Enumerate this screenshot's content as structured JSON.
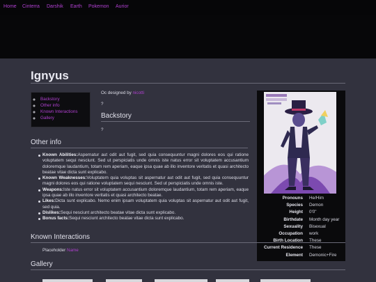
{
  "nav": [
    "Home",
    "Cinterra",
    "Darshik",
    "Earth",
    "Pokemon",
    "Aurior"
  ],
  "page_title": "Ignyus",
  "toc": [
    "Backstory",
    "Other info",
    "Known Interactions",
    "Gallery"
  ],
  "designed": {
    "prefix": "Oc designed by ",
    "designer": "nicotti"
  },
  "backstory": {
    "heading": "Backstory",
    "text": "?"
  },
  "intro_text": "?",
  "infobox": {
    "rows": [
      {
        "label": "Pronouns",
        "value": "He/Him"
      },
      {
        "label": "Species",
        "value": "Demon"
      },
      {
        "label": "Height",
        "value": "0'0\""
      },
      {
        "label": "Birthdate",
        "value": "Month day year"
      },
      {
        "label": "Sexuality",
        "value": "Bisexual"
      },
      {
        "label": "Occupation",
        "value": "work"
      },
      {
        "label": "Birth Location",
        "value": "These"
      },
      {
        "label": "Current Residence",
        "value": "These"
      },
      {
        "label": "Element",
        "value": "Demonic+Fire"
      }
    ]
  },
  "other_info": {
    "heading": "Other info",
    "facts": [
      {
        "label": "Known Abilities:",
        "text": "Aspernatur aut odit aut fugit, sed quia consequuntur magni dolores eos qui ratione voluptatem sequi nesciunt. Sed ut perspiciatis unde omnis iste natus error sit voluptatem accusantium doloremque laudantium, totam rem aperiam, eaque ipsa quae ab illo inventore veritatis et quasi architecto beatae vitae dicta sunt explicabo."
      },
      {
        "label": "Known Weaknesses:",
        "text": "Voluptatem quia voluptas sit aspernatur aut odit aut fugit, sed quia consequuntur magni dolores eos qui ratione voluptatem sequi nesciunt. Sed ut perspiciatis unde omnis iste."
      },
      {
        "label": "Weapons:",
        "text": "Iste natus error sit voluptatem accusantium doloremque laudantium, totam rem aperiam, eaque ipsa quae ab illo inventore veritatis et quasi architecto beatae."
      },
      {
        "label": "Likes:",
        "text": "Dicta sunt explicabo. Nemo enim ipsam voluptatem quia voluptas sit aspernatur aut odit aut fugit, sed quia."
      },
      {
        "label": "Dislikes:",
        "text": "Sequi nesciunt architecto beatae vitae dicta sunt explicabo."
      },
      {
        "label": "Bonus facts:",
        "text": "Sequi nesciunt architecto beatae vitae dicta sunt explicabo."
      }
    ]
  },
  "known_interactions": {
    "heading": "Known Interactions",
    "prefix": "Placeholder ",
    "name": "Name"
  },
  "gallery": {
    "heading": "Gallery"
  },
  "colors": {
    "accent": "#b040d0",
    "background": "#32323e",
    "nav_bg": "#060608"
  }
}
